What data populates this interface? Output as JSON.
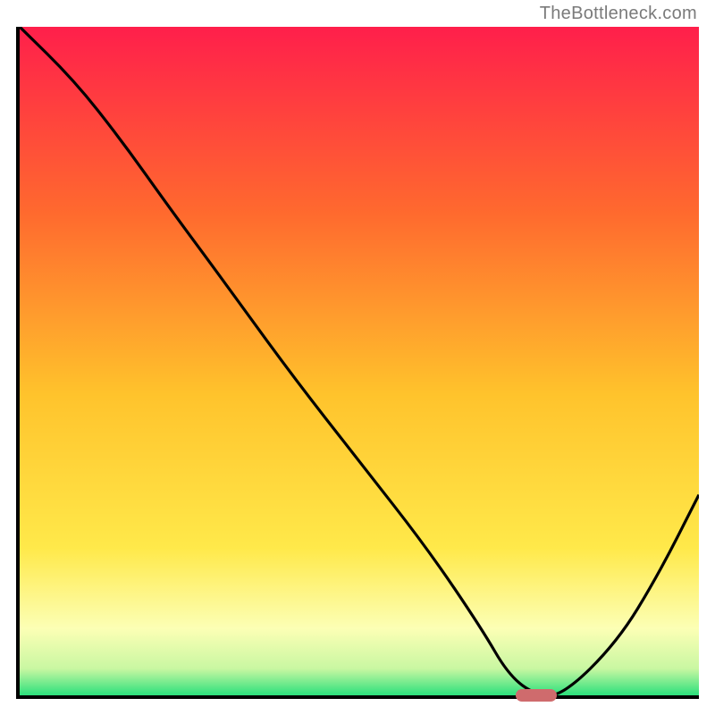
{
  "watermark": "TheBottleneck.com",
  "colors": {
    "line": "#000000",
    "marker": "#cf6b6d",
    "gradient_top": "#ff1f4b",
    "gradient_mid1": "#ff8a2a",
    "gradient_mid2": "#ffe337",
    "gradient_mid3": "#fdffae",
    "gradient_bottom": "#2be07c"
  },
  "chart_data": {
    "type": "line",
    "title": "",
    "xlabel": "",
    "ylabel": "",
    "xlim": [
      0,
      100
    ],
    "ylim": [
      0,
      100
    ],
    "x": [
      0,
      8,
      15,
      22,
      30,
      40,
      50,
      60,
      68,
      72,
      76,
      80,
      88,
      94,
      100
    ],
    "values": [
      100,
      92,
      83,
      73,
      62,
      48,
      35,
      22,
      10,
      3,
      0,
      0,
      8,
      18,
      30
    ],
    "marker": {
      "x": 76,
      "y": 0,
      "width": 6,
      "height": 2
    },
    "annotations": []
  }
}
